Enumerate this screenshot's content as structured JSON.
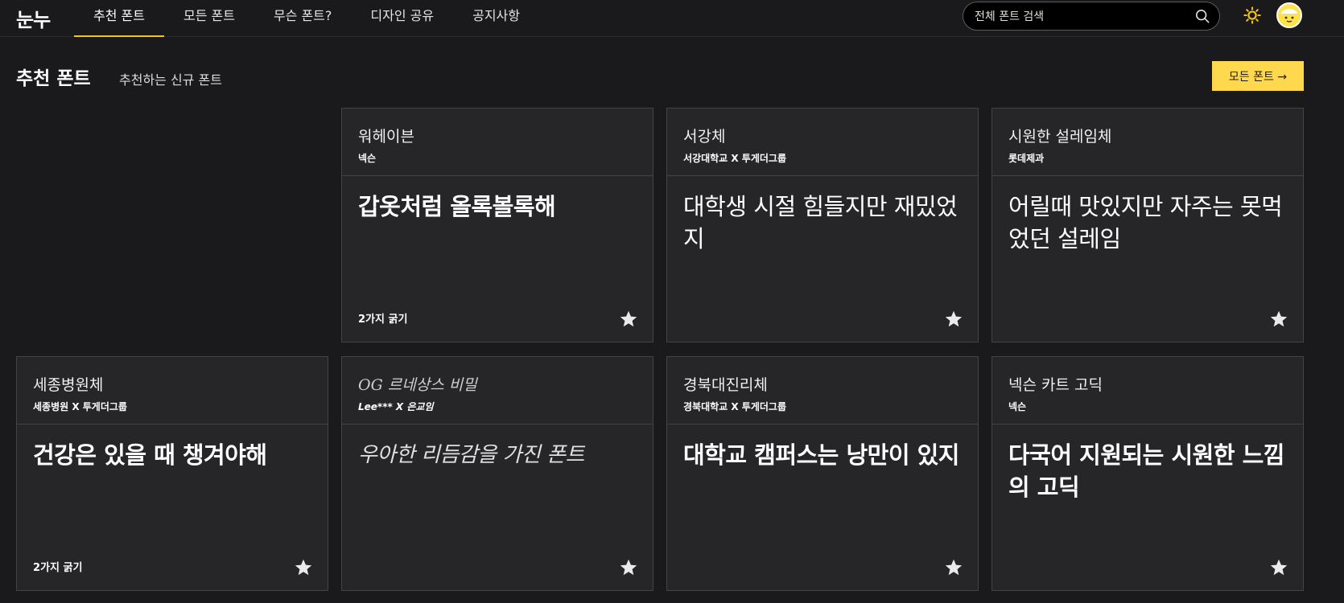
{
  "brand": {
    "logo": "눈누"
  },
  "nav": {
    "items": [
      {
        "label": "추천 폰트",
        "active": true
      },
      {
        "label": "모든 폰트",
        "active": false
      },
      {
        "label": "무슨 폰트?",
        "active": false
      },
      {
        "label": "디자인 공유",
        "active": false
      },
      {
        "label": "공지사항",
        "active": false
      }
    ]
  },
  "search": {
    "placeholder": "전체 폰트 검색",
    "value": ""
  },
  "icons": {
    "search": "search-icon",
    "theme": "sun-icon",
    "avatar": "avatar-face",
    "favorite": "star-icon"
  },
  "colors": {
    "accent": "#ffd84d",
    "background": "#1a1a1c",
    "card": "#262629",
    "border": "#434347"
  },
  "section": {
    "title": "추천 폰트",
    "subtitle": "추천하는 신규 폰트",
    "all_button": "모든 폰트 →"
  },
  "cards": [
    {
      "name": "워헤이븐",
      "maker": "넥슨",
      "sample": "갑옷처럼 올록볼록해",
      "weights": "2가지 굵기",
      "style": "bold"
    },
    {
      "name": "서강체",
      "maker": "서강대학교 X 투게더그룹",
      "sample": "대학생 시절 힘들지만 재밌었지",
      "weights": "",
      "style": "light"
    },
    {
      "name": "시원한 설레임체",
      "maker": "롯데제과",
      "sample": "어릴때 맛있지만 자주는 못먹었던 설레임",
      "weights": "",
      "style": "light"
    },
    {
      "name": "세종병원체",
      "maker": "세종병원 X 투게더그룹",
      "sample": "건강은 있을 때 챙겨야해",
      "weights": "2가지 굵기",
      "style": "bold"
    },
    {
      "name": "OG 르네상스 비밀",
      "maker": "Lee*** X 은교임",
      "sample": "우아한 리듬감을 가진 폰트",
      "weights": "",
      "style": "script"
    },
    {
      "name": "경북대진리체",
      "maker": "경북대학교 X 투게더그룹",
      "sample": "대학교 캠퍼스는 낭만이 있지",
      "weights": "",
      "style": "bold"
    },
    {
      "name": "넥슨 카트 고딕",
      "maker": "넥슨",
      "sample": "다국어 지원되는 시원한 느낌의 고딕",
      "weights": "",
      "style": "bold"
    }
  ]
}
